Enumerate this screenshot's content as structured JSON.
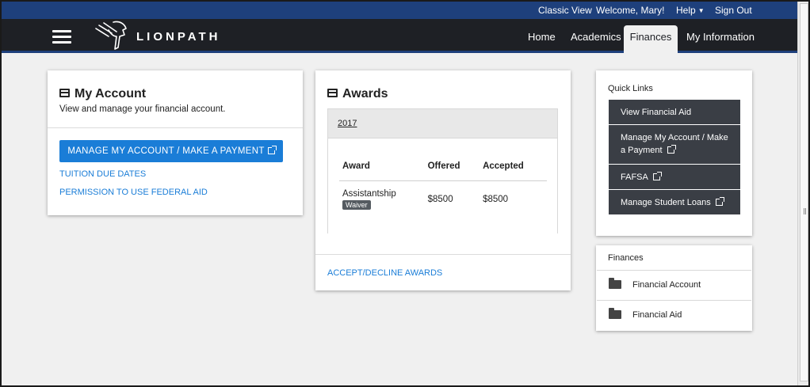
{
  "utility_bar": {
    "classic_view": "Classic View",
    "welcome": "Welcome, Mary!",
    "help": "Help",
    "sign_out": "Sign Out"
  },
  "navbar": {
    "logo_text": "LIONPATH",
    "items": [
      "Home",
      "Academics",
      "Finances",
      "My Information"
    ],
    "active": "Finances"
  },
  "my_account": {
    "title": "My Account",
    "subtitle": "View and manage your financial account.",
    "button_label": "MANAGE MY ACCOUNT / MAKE A PAYMENT",
    "links": [
      "TUITION DUE DATES",
      "PERMISSION TO USE FEDERAL AID"
    ]
  },
  "awards": {
    "title": "Awards",
    "year": "2017",
    "columns": [
      "Award",
      "Offered",
      "Accepted"
    ],
    "rows": [
      {
        "award": "Assistantship",
        "badge": "Waiver",
        "offered": "$8500",
        "accepted": "$8500"
      }
    ],
    "footer_link": "ACCEPT/DECLINE AWARDS"
  },
  "quick_links": {
    "title": "Quick Links",
    "items": [
      "View Financial Aid",
      "Manage My Account / Make a Payment",
      "FAFSA",
      "Manage Student Loans"
    ]
  },
  "finances": {
    "title": "Finances",
    "items": [
      "Financial Account",
      "Financial Aid"
    ]
  },
  "colors": {
    "brand_blue": "#1e407c",
    "nav_dark": "#1e2025",
    "link_blue": "#1a7dd7",
    "quick_link_bg": "#3a3e45"
  }
}
